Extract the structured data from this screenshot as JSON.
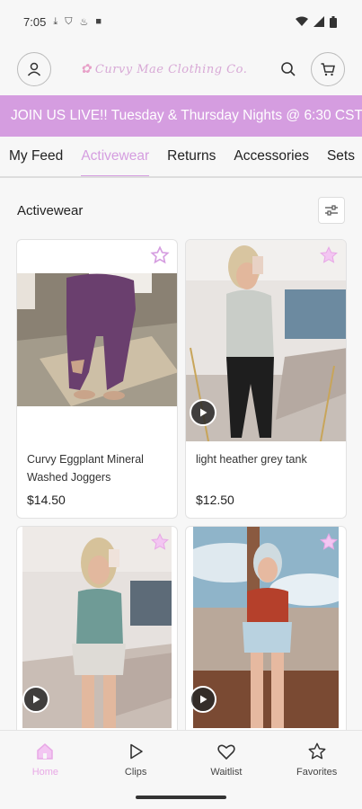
{
  "status": {
    "time": "7:05"
  },
  "header": {
    "logo_text": "Curvy Mae Clothing Co."
  },
  "banner": {
    "text": "JOIN US LIVE!! Tuesday & Thursday Nights @ 6:30 CST"
  },
  "tabs": [
    {
      "label": "My Feed"
    },
    {
      "label": "Activewear"
    },
    {
      "label": "Returns"
    },
    {
      "label": "Accessories"
    },
    {
      "label": "Sets"
    }
  ],
  "section": {
    "title": "Activewear"
  },
  "products": [
    {
      "name": "Curvy Eggplant Mineral Washed Joggers",
      "price": "$14.50"
    },
    {
      "name": "light heather grey tank",
      "price": "$12.50"
    },
    {
      "name": "",
      "price": ""
    },
    {
      "name": "",
      "price": ""
    }
  ],
  "bottom_nav": {
    "home": "Home",
    "clips": "Clips",
    "waitlist": "Waitlist",
    "favorites": "Favorites"
  },
  "colors": {
    "accent": "#d59de0",
    "nav_active": "#e8a9e6"
  }
}
